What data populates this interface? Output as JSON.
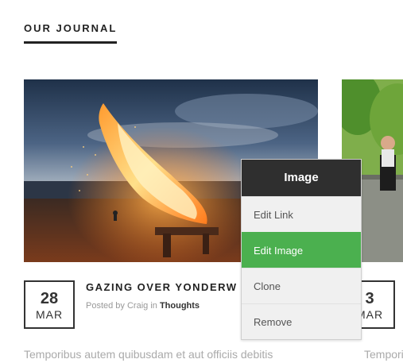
{
  "section": {
    "title": "OUR JOURNAL"
  },
  "posts": [
    {
      "day": "28",
      "month": "MAR",
      "title": "GAZING OVER YONDERW",
      "meta_prefix": "Posted by Craig in ",
      "category": "Thoughts",
      "excerpt": "Temporibus autem quibusdam et aut officiis debitis"
    },
    {
      "day": "3",
      "month": "MAR",
      "excerpt": "Temporibus"
    }
  ],
  "context_menu": {
    "title": "Image",
    "items": [
      "Edit Link",
      "Edit Image",
      "Clone",
      "Remove"
    ],
    "active_index": 1,
    "active_color": "#4bb04f",
    "header_color": "#2f2f2f"
  }
}
